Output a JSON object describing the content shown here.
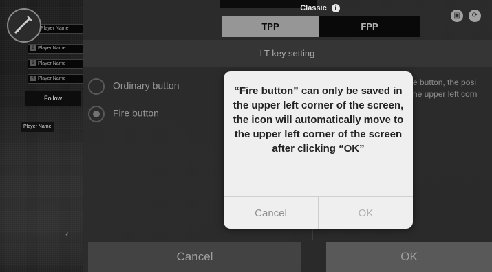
{
  "hud": {
    "players": [
      "Player Name",
      "Player Name",
      "Player Name",
      "Player Name"
    ],
    "player_numbers": [
      "1",
      "2",
      "3",
      "4"
    ],
    "follow_label": "Follow",
    "spectate_player": "Player Name",
    "back_chevron": "‹"
  },
  "header": {
    "mode_label": "Classic",
    "info_icon": "i",
    "tabs": [
      {
        "label": "TPP",
        "selected": true
      },
      {
        "label": "FPP",
        "selected": false
      }
    ],
    "icons": [
      "camera-icon",
      "refresh-icon"
    ]
  },
  "settings": {
    "title": "LT key setting",
    "options": [
      {
        "label": "Ordinary button",
        "selected": false
      },
      {
        "label": "Fire button",
        "selected": true
      }
    ],
    "description_line1": "e button, the posi",
    "description_line2": "he upper left corn",
    "cancel_label": "Cancel",
    "ok_label": "OK"
  },
  "dialog": {
    "message": "“Fire button” can only be saved in the upper left corner of the screen, the icon will automatically move to the upper left corner of the screen after clicking “OK”",
    "cancel_label": "Cancel",
    "ok_label": "OK"
  }
}
